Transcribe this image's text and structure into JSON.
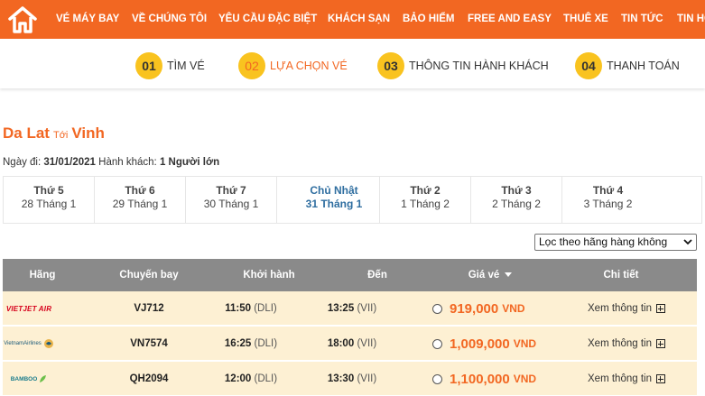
{
  "nav": {
    "items": [
      "VÉ MÁY BAY",
      "VỀ CHÚNG TÔI",
      "YÊU CẦU ĐẶC BIỆT",
      "KHÁCH SẠN",
      "BẢO HIỂM",
      "FREE AND EASY",
      "THUÊ XE",
      "TIN TỨC",
      "TIN HỘ"
    ],
    "home_icon": "home-icon",
    "color": "#f26722"
  },
  "steps": [
    {
      "num": "01",
      "label": "TÌM VÉ"
    },
    {
      "num": "02",
      "label": "LỰA CHỌN VÉ"
    },
    {
      "num": "03",
      "label": "THÔNG TIN HÀNH KHÁCH"
    },
    {
      "num": "04",
      "label": "THANH TOÁN"
    }
  ],
  "route": {
    "from": "Da Lat",
    "to_word": "Tới",
    "to": "Vinh"
  },
  "info": {
    "date_label": "Ngày đi:",
    "date": "31/01/2021",
    "pax_label": "Hành khách:",
    "pax": "1 Người lớn"
  },
  "dates": [
    {
      "day": "Thứ 5",
      "date": "28 Tháng 1"
    },
    {
      "day": "Thứ 6",
      "date": "29 Tháng 1"
    },
    {
      "day": "Thứ 7",
      "date": "30 Tháng 1"
    },
    {
      "day": "Chủ Nhật",
      "date": "31 Tháng 1"
    },
    {
      "day": "Thứ 2",
      "date": "1 Tháng 2"
    },
    {
      "day": "Thứ 3",
      "date": "2 Tháng 2"
    },
    {
      "day": "Thứ 4",
      "date": "3 Tháng 2"
    }
  ],
  "filter": {
    "selected": "Lọc theo hãng hàng không"
  },
  "table": {
    "headers": [
      "Hãng",
      "Chuyến bay",
      "Khởi hành",
      "Đến",
      "Giá vé",
      "Chi tiết"
    ],
    "rows": [
      {
        "airline_logo": "VIETJET AIR",
        "flight": "VJ712",
        "dep_time": "11:50",
        "dep_code": "(DLI)",
        "arr_time": "13:25",
        "arr_code": "(VII)",
        "price": "919,000",
        "currency": "VND",
        "detail": "Xem thông tin"
      },
      {
        "airline_logo": "VietnamAirlines",
        "flight": "VN7574",
        "dep_time": "16:25",
        "dep_code": "(DLI)",
        "arr_time": "18:00",
        "arr_code": "(VII)",
        "price": "1,009,000",
        "currency": "VND",
        "detail": "Xem thông tin"
      },
      {
        "airline_logo": "BAMBOO",
        "flight": "QH2094",
        "dep_time": "12:00",
        "dep_code": "(DLI)",
        "arr_time": "13:30",
        "arr_code": "(VII)",
        "price": "1,100,000",
        "currency": "VND",
        "detail": "Xem thông tin"
      }
    ]
  }
}
